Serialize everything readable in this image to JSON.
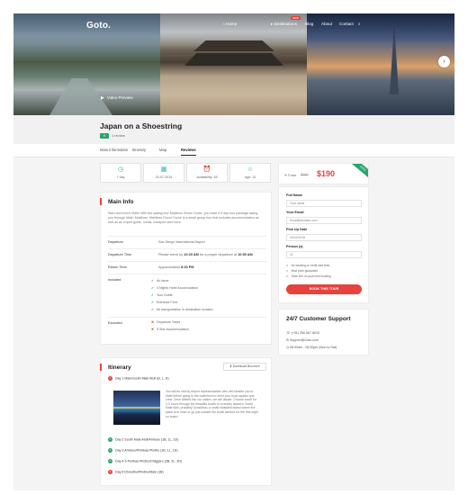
{
  "site": {
    "logo": "Goto."
  },
  "nav": {
    "items": [
      {
        "label": "Home",
        "active": true
      },
      {
        "label": "Destinations"
      },
      {
        "label": "Blog"
      },
      {
        "label": "About"
      },
      {
        "label": "Contact"
      }
    ],
    "badge": "NEW"
  },
  "hero": {
    "video_label": "Video Preview"
  },
  "tour": {
    "title": "Japan on a Shoestring",
    "rating": "9",
    "reviews": "1 review"
  },
  "tabs": [
    "Main Information",
    "Itinerary",
    "Map",
    "Reviews"
  ],
  "active_tab": "Reviews",
  "stats": [
    {
      "icon": "clock-icon",
      "label": "7 day"
    },
    {
      "icon": "calendar-icon",
      "label": "20-07-2015"
    },
    {
      "icon": "alarm-icon",
      "label": "Availability: 48"
    },
    {
      "icon": "person-icon",
      "label": "Age: 13"
    }
  ],
  "main_info": {
    "title": "Main Info",
    "description": "Start and end in Malé! With the sailing tour Maldives Dhoni Cruise, you have a 9 day tour package taking you through Malé, Maldives. Maldives Dhoni Cruise is a small group tour that includes accommodation as well as an expert guide, meals, transport and more.",
    "rows": [
      {
        "label": "Departure",
        "value": "San Diego International Airport"
      },
      {
        "label": "Departure Time",
        "prefix": "Please arrive by ",
        "time1": "10:20 AM",
        "middle": " for a proper departure at ",
        "time2": "10:50 AM"
      },
      {
        "label": "Return Time",
        "prefix": "Approximately ",
        "time": "8:30 PM"
      }
    ],
    "included_label": "Included",
    "included": [
      "Air fares",
      "4 Nights Hotel Accomodation",
      "Tour Guide",
      "Entrance Fees",
      "All transportation in destination location"
    ],
    "excluded_label": "Excluded",
    "excluded": [
      "Departure Taxes",
      "5 Star Accommodation"
    ]
  },
  "itinerary": {
    "title": "Itinerary",
    "download": "Download Brochure",
    "day1": "Day 1 Male/South Malé Atoll (B, L, D)",
    "day1_text": "You will be met by airport representatives who will transfer you to Malé before going to the waterfront to meet your boat captain and crew. Once settled into our cabins, we will depart. Choose south for 2-3 hours through the beautiful Kaafu to a nearby island in South Malé Atoll, probably Guraidhoo, a small inhabited island where the place is to relax or go just outside the small harbour for the first night on board.",
    "days": [
      "Day 2 South Malé Atoll/Ambaru (1B, 1L, 1D)",
      "Day 3 Ambaru/Pinhbaa Pindhu (1B, 1L, 1D)",
      "Day 4-5 Penbaa Pindhu/Dhiggaru (2B, 2L, 2D)",
      "Day 6 Dhoodhu/Pindhu/Malé (1B)"
    ]
  },
  "booking": {
    "from_label": "From",
    "old_price": "$250",
    "price": "$190",
    "ribbon": "SAVE",
    "fields": [
      {
        "label": "Full Name",
        "placeholder": "Your name"
      },
      {
        "label": "Your Email",
        "placeholder": "Email@domain.com"
      },
      {
        "label": "Pick Up Date",
        "placeholder": "03/02/2018"
      },
      {
        "label": "Person (s)",
        "placeholder": "01"
      }
    ],
    "notes": [
      "No booking or credit card fees",
      "Best price guarantee",
      "Save $10 on your next booking"
    ],
    "button": "BOOK THIS TOUR"
  },
  "support": {
    "title": "24/7 Customer Support",
    "phone": "(+91) 256 567 8910",
    "email": "Support@Goto.com",
    "hours": "08:00am - 05:30pm (Mon to Sat)"
  },
  "colors": {
    "accent": "#e5433b",
    "teal": "#2ab3a6",
    "green": "#2aa56c"
  }
}
